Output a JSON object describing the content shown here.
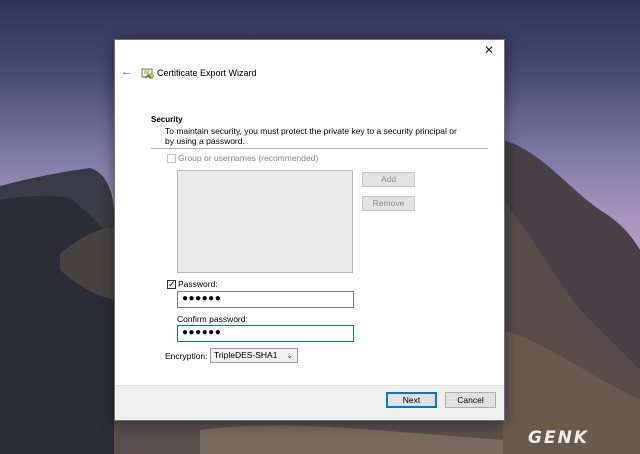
{
  "wizard": {
    "title": "Certificate Export Wizard",
    "close_glyph": "✕",
    "back_glyph": "←"
  },
  "security": {
    "heading": "Security",
    "description": "To maintain security, you must protect the private key to a security principal or by using a password.",
    "group_checkbox_label": "Group or usernames (recommended)",
    "group_checked": false,
    "add_label": "Add",
    "remove_label": "Remove",
    "password_checkbox_label": "Password:",
    "password_checked": true,
    "password_value": "●●●●●●",
    "confirm_label": "Confirm password:",
    "confirm_value": "●●●●●●",
    "encryption_label": "Encryption:",
    "encryption_value": "TripleDES-SHA1",
    "chevron_glyph": "⌄"
  },
  "footer": {
    "next_label": "Next",
    "cancel_label": "Cancel"
  },
  "watermark": "GENK"
}
